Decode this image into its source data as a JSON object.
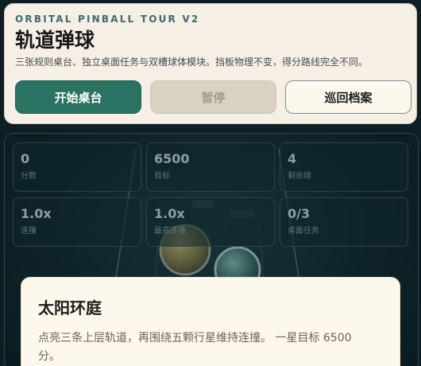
{
  "header": {
    "eyebrow": "ORBITAL PINBALL TOUR V2",
    "title": "轨道弹球",
    "subtitle": "三张规则桌台、独立桌面任务与双槽球体模块。挡板物理不变，得分路线完全不同。",
    "buttons": {
      "start": "开始桌台",
      "pause": "暂停",
      "archive": "巡回档案"
    }
  },
  "stats": [
    {
      "value": "0",
      "label": "分数"
    },
    {
      "value": "6500",
      "label": "目标"
    },
    {
      "value": "4",
      "label": "剩余球"
    },
    {
      "value": "1.0x",
      "label": "连撞"
    },
    {
      "value": "1.0x",
      "label": "最高连撞"
    },
    {
      "value": "0/3",
      "label": "桌面任务"
    }
  ],
  "table_card": {
    "title": "太阳环庭",
    "description": "点亮三条上层轨道，再围绕五颗行星维持连撞。 一星目标 6500 分。"
  },
  "colors": {
    "accent": "#2a7363",
    "background": "#0d1f24",
    "card": "#f5efe6"
  }
}
